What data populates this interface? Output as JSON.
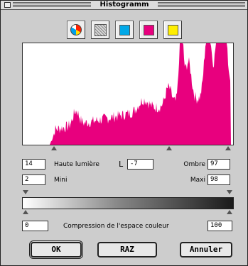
{
  "window": {
    "title": "Histogramm"
  },
  "channels": [
    {
      "name": "all-channels",
      "icon": "color-wheel-icon"
    },
    {
      "name": "luminance",
      "icon": "gray-pattern-icon"
    },
    {
      "name": "cyan",
      "color": "#00a8e8"
    },
    {
      "name": "magenta",
      "color": "#e8007e"
    },
    {
      "name": "yellow",
      "color": "#ffee00"
    }
  ],
  "histogram": {
    "color": "#e8007e"
  },
  "highlight": {
    "value": "14",
    "label": "Haute lumière"
  },
  "midpoint": {
    "icon_glyph": "L",
    "value": "-7"
  },
  "shadow": {
    "value": "97",
    "label": "Ombre"
  },
  "mini": {
    "value": "2",
    "label": "Mini"
  },
  "maxi": {
    "value": "98",
    "label": "Maxi"
  },
  "compression": {
    "min": "0",
    "label": "Compression de l'espace couleur",
    "max": "100"
  },
  "buttons": {
    "ok": "OK",
    "reset": "RAZ",
    "cancel": "Annuler"
  }
}
